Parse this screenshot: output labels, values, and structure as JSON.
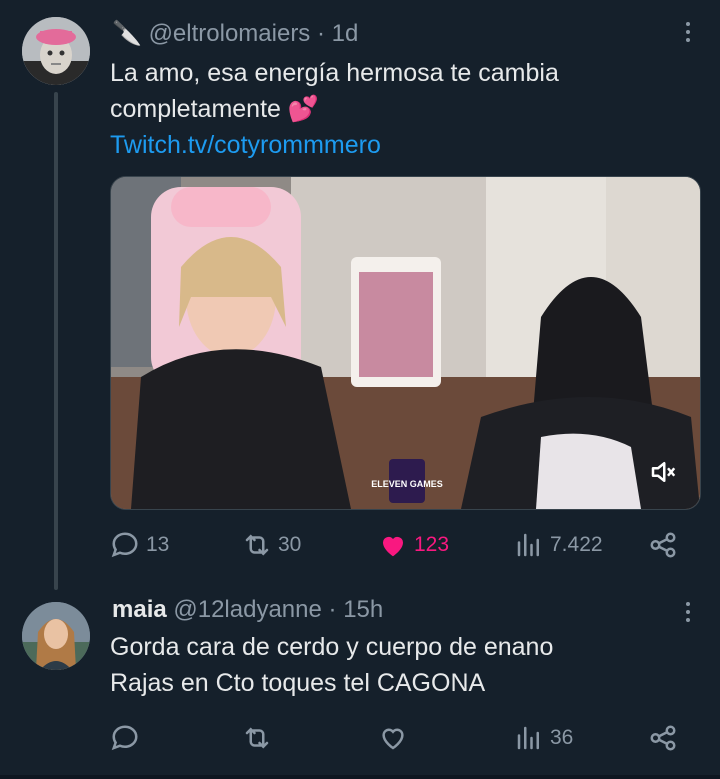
{
  "tweets": [
    {
      "emoji": "🔪",
      "handle": "@eltrolomaiers",
      "separator": "·",
      "time": "1d",
      "text_line1": "La amo, esa energía hermosa te cambia",
      "text_line2": "completamente 💕",
      "link": "Twitch.tv/cotyrommmero",
      "media_badge": "ELEVEN GAMES",
      "stats": {
        "replies": "13",
        "retweets": "30",
        "likes": "123",
        "views": "7.422"
      },
      "liked": true
    },
    {
      "name": "maia",
      "handle": "@12ladyanne",
      "separator": "·",
      "time": "15h",
      "text_line1": "Gorda cara de cerdo y cuerpo de enano",
      "text_line2": "Rajas en Cto toques tel CAGONA",
      "stats": {
        "replies": "",
        "retweets": "",
        "likes": "",
        "views": "36"
      },
      "liked": false
    }
  ],
  "colors": {
    "background": "#15202b",
    "text": "#e7e9ea",
    "muted": "#8b98a5",
    "link": "#1d9bf0",
    "like": "#f91880"
  }
}
